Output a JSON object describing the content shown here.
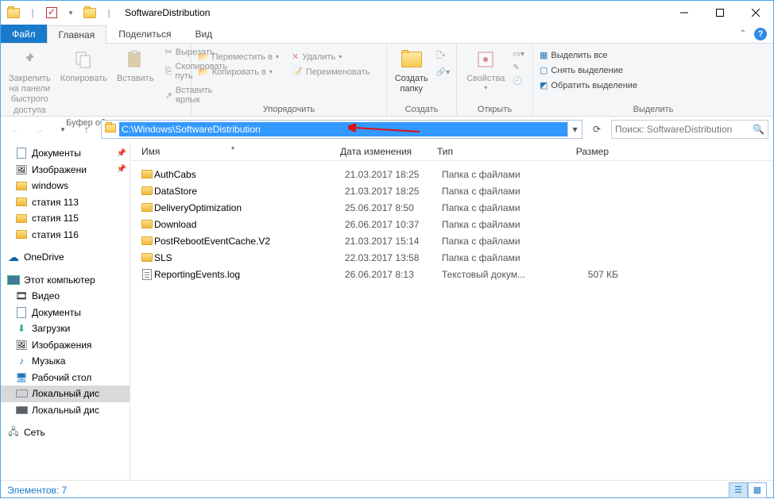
{
  "window": {
    "title": "SoftwareDistribution"
  },
  "tabs": {
    "file": "Файл",
    "home": "Главная",
    "share": "Поделиться",
    "view": "Вид"
  },
  "ribbon": {
    "pin": "Закрепить на панели\nбыстрого доступа",
    "copy": "Копировать",
    "paste": "Вставить",
    "cut": "Вырезать",
    "copypath": "Скопировать путь",
    "pasteshortcut": "Вставить ярлык",
    "clipboard_label": "Буфер обмена",
    "moveto": "Переместить в",
    "copyto": "Копировать в",
    "delete": "Удалить",
    "rename": "Переименовать",
    "organize_label": "Упорядочить",
    "newfolder": "Создать\nпапку",
    "create_label": "Создать",
    "properties": "Свойства",
    "open_label": "Открыть",
    "selectall": "Выделить все",
    "deselect": "Снять выделение",
    "invert": "Обратить выделение",
    "select_label": "Выделить"
  },
  "address": {
    "path": "C:\\Windows\\SoftwareDistribution"
  },
  "search": {
    "placeholder": "Поиск: SoftwareDistribution"
  },
  "columns": {
    "name": "Имя",
    "date": "Дата изменения",
    "type": "Тип",
    "size": "Размер"
  },
  "sidebar": {
    "docs": "Документы",
    "images": "Изображени",
    "windows": "windows",
    "s113": "статия 113",
    "s115": "статия 115",
    "s116": "статия 116",
    "onedrive": "OneDrive",
    "thispc": "Этот компьютер",
    "video": "Видео",
    "docs2": "Документы",
    "downloads": "Загрузки",
    "images2": "Изображения",
    "music": "Музыка",
    "desktop": "Рабочий стол",
    "localdisk1": "Локальный дис",
    "localdisk2": "Локальный дис",
    "network": "Сеть"
  },
  "files": [
    {
      "name": "AuthCabs",
      "date": "21.03.2017 18:25",
      "type": "Папка с файлами",
      "size": "",
      "kind": "folder"
    },
    {
      "name": "DataStore",
      "date": "21.03.2017 18:25",
      "type": "Папка с файлами",
      "size": "",
      "kind": "folder"
    },
    {
      "name": "DeliveryOptimization",
      "date": "25.06.2017 8:50",
      "type": "Папка с файлами",
      "size": "",
      "kind": "folder"
    },
    {
      "name": "Download",
      "date": "26.06.2017 10:37",
      "type": "Папка с файлами",
      "size": "",
      "kind": "folder"
    },
    {
      "name": "PostRebootEventCache.V2",
      "date": "21.03.2017 15:14",
      "type": "Папка с файлами",
      "size": "",
      "kind": "folder"
    },
    {
      "name": "SLS",
      "date": "22.03.2017 13:58",
      "type": "Папка с файлами",
      "size": "",
      "kind": "folder"
    },
    {
      "name": "ReportingEvents.log",
      "date": "26.06.2017 8:13",
      "type": "Текстовый докум...",
      "size": "507 КБ",
      "kind": "file"
    }
  ],
  "status": {
    "count": "Элементов: 7"
  }
}
